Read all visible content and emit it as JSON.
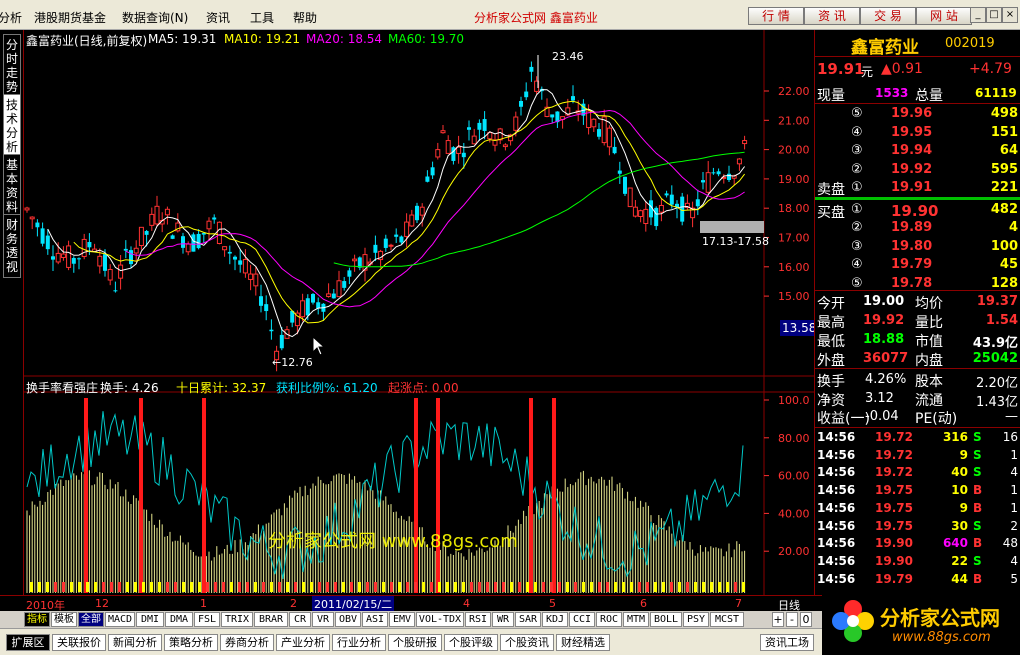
{
  "menu": {
    "items": [
      "分析",
      "港股期货基金",
      "数据查询(N)",
      "资讯",
      "工具",
      "帮助"
    ],
    "center_title": "分析家公式网  鑫富药业",
    "quick_buttons": [
      "行 情",
      "资 讯",
      "交 易",
      "网 站"
    ],
    "window_buttons": [
      "_",
      "□",
      "×"
    ]
  },
  "vtabs": [
    "分时走势",
    "技术分析",
    "基本资料",
    "财务透视"
  ],
  "main_chart": {
    "stock_label": "鑫富药业(日线,前复权)",
    "ma5": "MA5: 19.31",
    "ma10": "MA10: 19.21",
    "ma20": "MA20: 18.54",
    "ma60": "MA60: 19.70",
    "price_ticks": [
      "22.00",
      "21.00",
      "20.00",
      "19.00",
      "18.00",
      "17.00",
      "16.00",
      "15.00"
    ],
    "current_price_tag": "13.58",
    "high_annotation": "23.46",
    "low_annotation": "←12.76",
    "range_annotation": "17.13-17.58"
  },
  "sub_chart": {
    "title": "换手率看强庄",
    "turnover": "换手: 4.26",
    "ten_day": "十日累计: 32.37",
    "profit_ratio": "获利比例%: 61.20",
    "launch_point": "起涨点: 0.00",
    "ticks": [
      "100.0",
      "80.00",
      "60.00",
      "40.00",
      "20.00"
    ],
    "watermark": "分析家公式网  www.88gs.com"
  },
  "time_axis": {
    "labels": [
      "2010年",
      "12",
      "1",
      "2",
      "2011/02/15/二",
      "4",
      "5",
      "6",
      "7"
    ],
    "period": "日线",
    "nav": [
      "+",
      "-",
      "0"
    ]
  },
  "indicator_tabs": [
    "指标",
    "模板",
    "全部",
    "MACD",
    "DMI",
    "DMA",
    "FSL",
    "TRIX",
    "BRAR",
    "CR",
    "VR",
    "OBV",
    "ASI",
    "EMV",
    "VOL-TDX",
    "RSI",
    "WR",
    "SAR",
    "KDJ",
    "CCI",
    "ROC",
    "MTM",
    "BOLL",
    "PSY",
    "MCST"
  ],
  "bottom_tabs": [
    "扩展区",
    "关联报价",
    "新闻分析",
    "策略分析",
    "券商分析",
    "产业分析",
    "行业分析",
    "个股研报",
    "个股评级",
    "个股资讯",
    "财经精选"
  ],
  "bottom_right": "资讯工场",
  "panel": {
    "name": "鑫富药业",
    "code": "002019",
    "price": "19.91",
    "price_unit": "元",
    "change": "▲0.91",
    "change_pct": "+4.79",
    "xianliang_label": "现量",
    "xianliang": "1533",
    "zongliang_label": "总量",
    "zongliang": "61119",
    "sell_label": "卖盘",
    "buy_label": "买盘",
    "asks": [
      {
        "lvl": "⑤",
        "price": "19.96",
        "vol": "498"
      },
      {
        "lvl": "④",
        "price": "19.95",
        "vol": "151"
      },
      {
        "lvl": "③",
        "price": "19.94",
        "vol": "64"
      },
      {
        "lvl": "②",
        "price": "19.92",
        "vol": "595"
      },
      {
        "lvl": "①",
        "price": "19.91",
        "vol": "221"
      }
    ],
    "bids": [
      {
        "lvl": "①",
        "price": "19.90",
        "vol": "482"
      },
      {
        "lvl": "②",
        "price": "19.89",
        "vol": "4"
      },
      {
        "lvl": "③",
        "price": "19.80",
        "vol": "100"
      },
      {
        "lvl": "④",
        "price": "19.79",
        "vol": "45"
      },
      {
        "lvl": "⑤",
        "price": "19.78",
        "vol": "128"
      }
    ],
    "stats": [
      {
        "l1": "今开",
        "v1": "19.00",
        "l2": "均价",
        "v2": "19.37"
      },
      {
        "l1": "最高",
        "v1": "19.92",
        "l2": "量比",
        "v2": "1.54"
      },
      {
        "l1": "最低",
        "v1": "18.88",
        "l2": "市值",
        "v2": "43.9亿"
      },
      {
        "l1": "外盘",
        "v1": "36077",
        "l2": "内盘",
        "v2": "25042"
      }
    ],
    "stats2": [
      {
        "l1": "换手",
        "v1": "4.26%",
        "l2": "股本",
        "v2": "2.20亿"
      },
      {
        "l1": "净资",
        "v1": "3.12",
        "l2": "流通",
        "v2": "1.43亿"
      },
      {
        "l1": "收益(一)",
        "v1": "-0.04",
        "l2": "PE(动)",
        "v2": "—"
      }
    ],
    "trades": [
      {
        "t": "14:56",
        "p": "19.72",
        "v": "316",
        "bs": "S",
        "n": "16"
      },
      {
        "t": "14:56",
        "p": "19.72",
        "v": "9",
        "bs": "S",
        "n": "1"
      },
      {
        "t": "14:56",
        "p": "19.72",
        "v": "40",
        "bs": "S",
        "n": "4"
      },
      {
        "t": "14:56",
        "p": "19.75",
        "v": "10",
        "bs": "B",
        "n": "1"
      },
      {
        "t": "14:56",
        "p": "19.75",
        "v": "9",
        "bs": "B",
        "n": "1"
      },
      {
        "t": "14:56",
        "p": "19.75",
        "v": "30",
        "bs": "S",
        "n": "2"
      },
      {
        "t": "14:56",
        "p": "19.90",
        "v": "640",
        "bs": "B",
        "n": "48"
      },
      {
        "t": "14:56",
        "p": "19.90",
        "v": "22",
        "bs": "S",
        "n": "4"
      },
      {
        "t": "14:56",
        "p": "19.79",
        "v": "44",
        "bs": "B",
        "n": "5"
      }
    ]
  },
  "logo_text": "分析家公式网",
  "logo_url": "www.88gs.com",
  "colors": {
    "up": "#ff3232",
    "down": "#00e5ff",
    "ma5": "#ffffff",
    "ma10": "#ffff00",
    "ma20": "#ff00ff",
    "ma60": "#00ff00",
    "panel_gold": "#ffcc00"
  }
}
